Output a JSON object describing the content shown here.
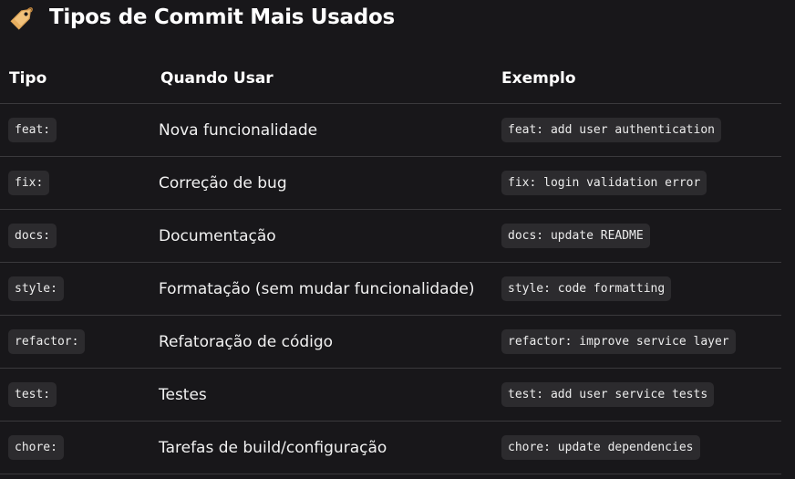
{
  "heading": {
    "icon": "label-tag-icon",
    "title": "Tipos de Commit Mais Usados"
  },
  "table": {
    "headers": [
      "Tipo",
      "Quando Usar",
      "Exemplo"
    ],
    "rows": [
      {
        "type": "feat:",
        "when": "Nova funcionalidade",
        "example": "feat: add user authentication"
      },
      {
        "type": "fix:",
        "when": "Correção de bug",
        "example": "fix: login validation error"
      },
      {
        "type": "docs:",
        "when": "Documentação",
        "example": "docs: update README"
      },
      {
        "type": "style:",
        "when": "Formatação (sem mudar funcionalidade)",
        "example": "style: code formatting"
      },
      {
        "type": "refactor:",
        "when": "Refatoração de código",
        "example": "refactor: improve service layer"
      },
      {
        "type": "test:",
        "when": "Testes",
        "example": "test: add user service tests"
      },
      {
        "type": "chore:",
        "when": "Tarefas de build/configuração",
        "example": "chore: update dependencies"
      }
    ]
  }
}
